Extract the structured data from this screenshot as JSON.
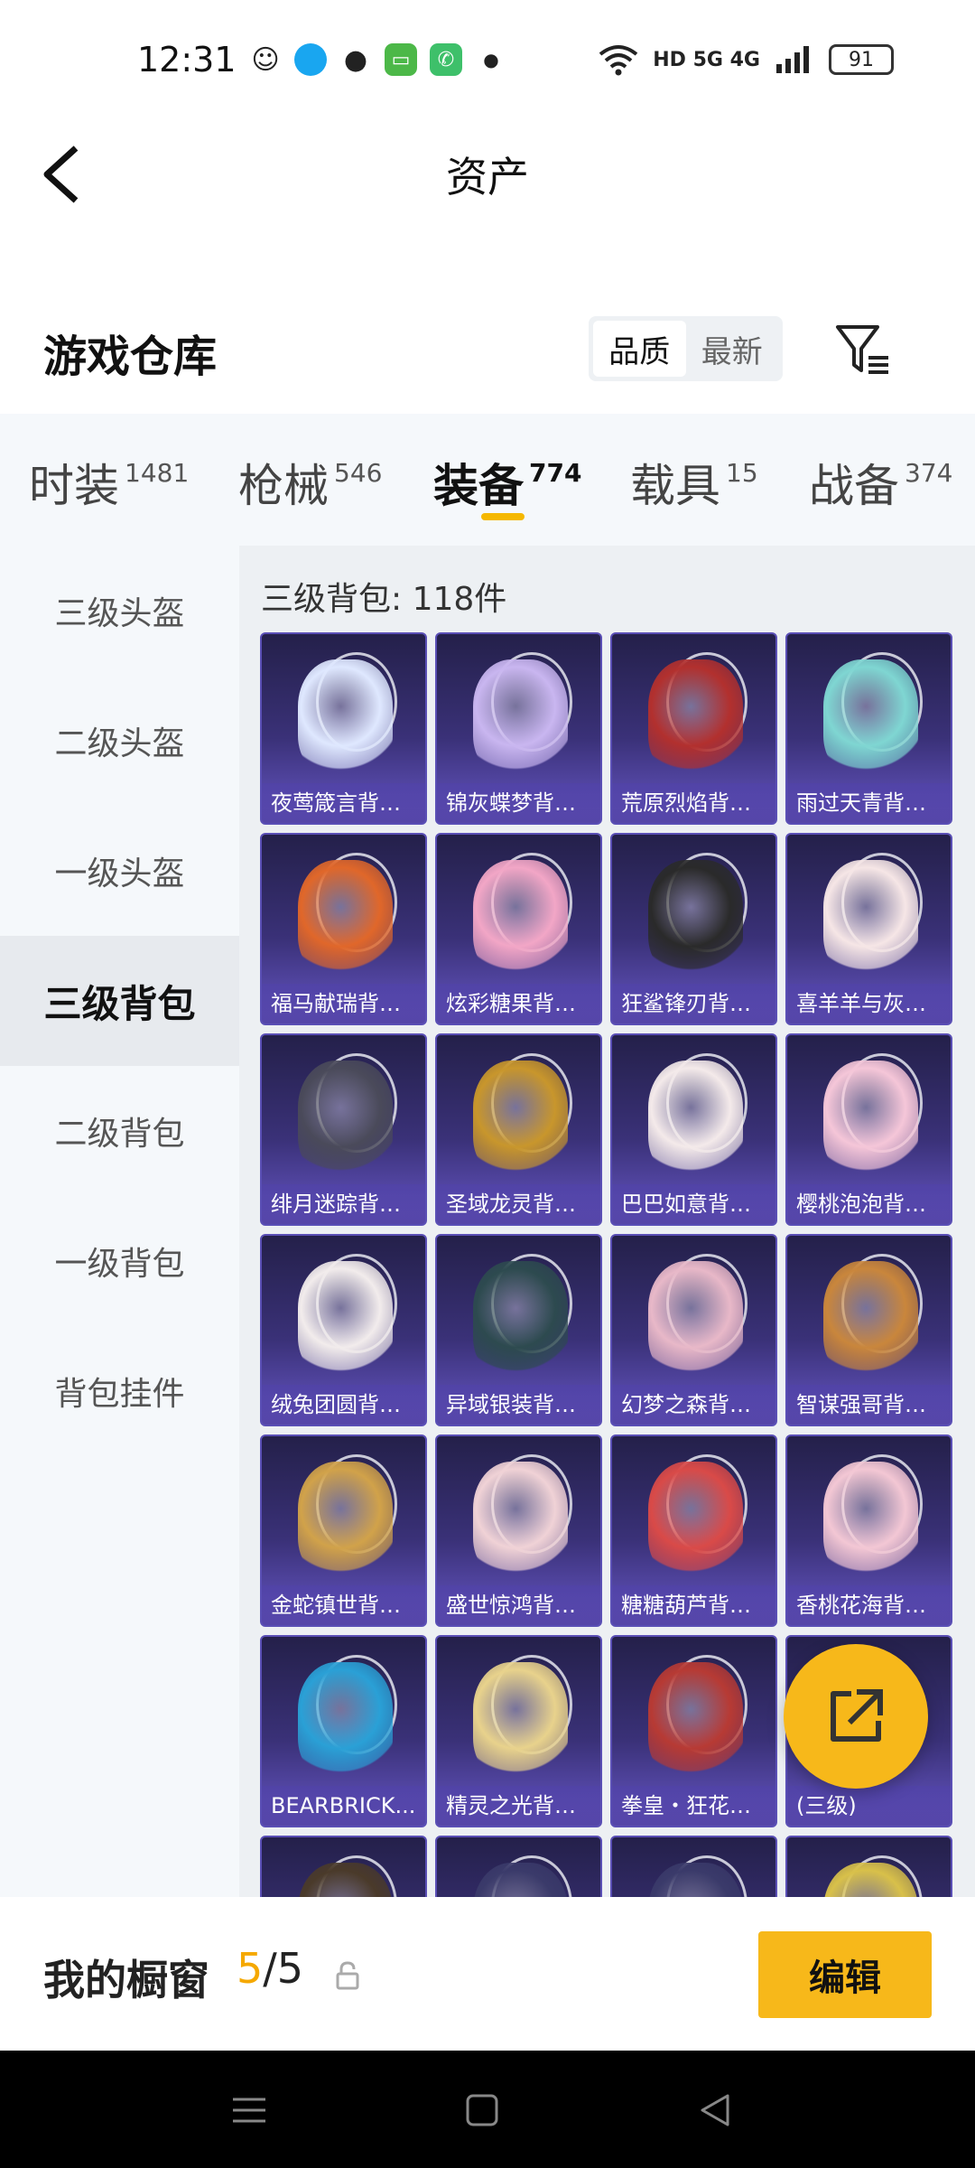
{
  "status_bar": {
    "time": "12:31",
    "network": "HD 5G 4G",
    "battery": "91",
    "app_icons": [
      "qq-chat-icon",
      "qq-icon",
      "wechat-icon",
      "message-icon",
      "phone-icon",
      "dot-icon"
    ]
  },
  "header": {
    "title": "资产"
  },
  "warehouse": {
    "title": "游戏仓库",
    "sort_options": [
      "品质",
      "最新"
    ],
    "sort_selected": "品质"
  },
  "tabs": [
    {
      "label": "时装",
      "count": "1481"
    },
    {
      "label": "枪械",
      "count": "546"
    },
    {
      "label": "装备",
      "count": "774",
      "active": true
    },
    {
      "label": "载具",
      "count": "15"
    },
    {
      "label": "战备",
      "count": "374"
    }
  ],
  "sidebar": {
    "items": [
      {
        "label": "三级头盔"
      },
      {
        "label": "二级头盔"
      },
      {
        "label": "一级头盔"
      },
      {
        "label": "三级背包",
        "active": true
      },
      {
        "label": "二级背包"
      },
      {
        "label": "一级背包"
      },
      {
        "label": "背包挂件"
      }
    ]
  },
  "content": {
    "count_label": "三级背包: 118件",
    "items": [
      {
        "name": "夜莺箴言背包(三级)",
        "display": "夜莺箴言背包...",
        "color": "#dfe8ff"
      },
      {
        "name": "锦灰蝶梦背包(三级)",
        "display": "锦灰蝶梦背包...",
        "color": "#c9b6f0"
      },
      {
        "name": "荒原烈焰背包(三级)",
        "display": "荒原烈焰背包...",
        "color": "#b2302e"
      },
      {
        "name": "雨过天青背包(三级)",
        "display": "雨过天青背包...",
        "color": "#7fd6d2"
      },
      {
        "name": "福马献瑞背包(三级)",
        "display": "福马献瑞背包...",
        "color": "#e0672a"
      },
      {
        "name": "炫彩糖果背包(三级)",
        "display": "炫彩糖果背包...",
        "color": "#f2a6c6"
      },
      {
        "name": "狂鲨锋刃背包(三级)",
        "display": "狂鲨锋刃背包...",
        "color": "#2a2a2a"
      },
      {
        "name": "喜羊羊与灰太狼背包(三级)",
        "display": "喜羊羊与灰太...",
        "color": "#f6e6e6"
      },
      {
        "name": "绯月迷踪背包(三级)",
        "display": "绯月迷踪背包...",
        "color": "#4a4a5a"
      },
      {
        "name": "圣域龙灵背包(三级)",
        "display": "圣域龙灵背包...",
        "color": "#c8962c"
      },
      {
        "name": "巴巴如意背包(三级)",
        "display": "巴巴如意背包...",
        "color": "#f4eaea"
      },
      {
        "name": "樱桃泡泡背包(三级)",
        "display": "樱桃泡泡背包...",
        "color": "#f5c6d8"
      },
      {
        "name": "绒兔团圆背包(三级)",
        "display": "绒兔团圆背包...",
        "color": "#f2ecec"
      },
      {
        "name": "异域银装背包(三级)",
        "display": "异域银装背包...",
        "color": "#2d4a4f"
      },
      {
        "name": "幻梦之森背包(三级)",
        "display": "幻梦之森背包...",
        "color": "#e8b8c8"
      },
      {
        "name": "智谋强哥背包(三级)",
        "display": "智谋强哥背包...",
        "color": "#c9863c"
      },
      {
        "name": "金蛇镇世背包(三级)",
        "display": "金蛇镇世背包...",
        "color": "#d1a24a"
      },
      {
        "name": "盛世惊鸿背包(三级)",
        "display": "盛世惊鸿背包...",
        "color": "#f0d2d6"
      },
      {
        "name": "糖糖葫芦背包(三级)",
        "display": "糖糖葫芦背包...",
        "color": "#d94a48"
      },
      {
        "name": "香桃花海背包(三级)",
        "display": "香桃花海背包...",
        "color": "#f3c7d4"
      },
      {
        "name": "BEARBRICK背包(三级)",
        "display": "BEARBRICK...",
        "color": "#2aa0d6"
      },
      {
        "name": "精灵之光背包(三级)",
        "display": "精灵之光背包...",
        "color": "#e8d28c"
      },
      {
        "name": "拳皇・狂花道背包(三级)",
        "display": "拳皇・狂花道...",
        "color": "#b73a34"
      },
      {
        "name": "背包(三级)",
        "display": "(三级)",
        "color": "#3a3a4a"
      },
      {
        "name": "",
        "display": "",
        "color": "#4a3a2a"
      },
      {
        "name": "",
        "display": "",
        "color": "#3a3a6a"
      },
      {
        "name": "",
        "display": "",
        "color": "#3a3a6a"
      },
      {
        "name": "",
        "display": "",
        "color": "#d8c04a"
      }
    ]
  },
  "showcase": {
    "label": "我的橱窗",
    "current": "5",
    "total": "/5",
    "edit_label": "编辑"
  },
  "colors": {
    "accent": "#f7b81a",
    "card_top": "#24204a",
    "card_bottom": "#6656c4"
  }
}
